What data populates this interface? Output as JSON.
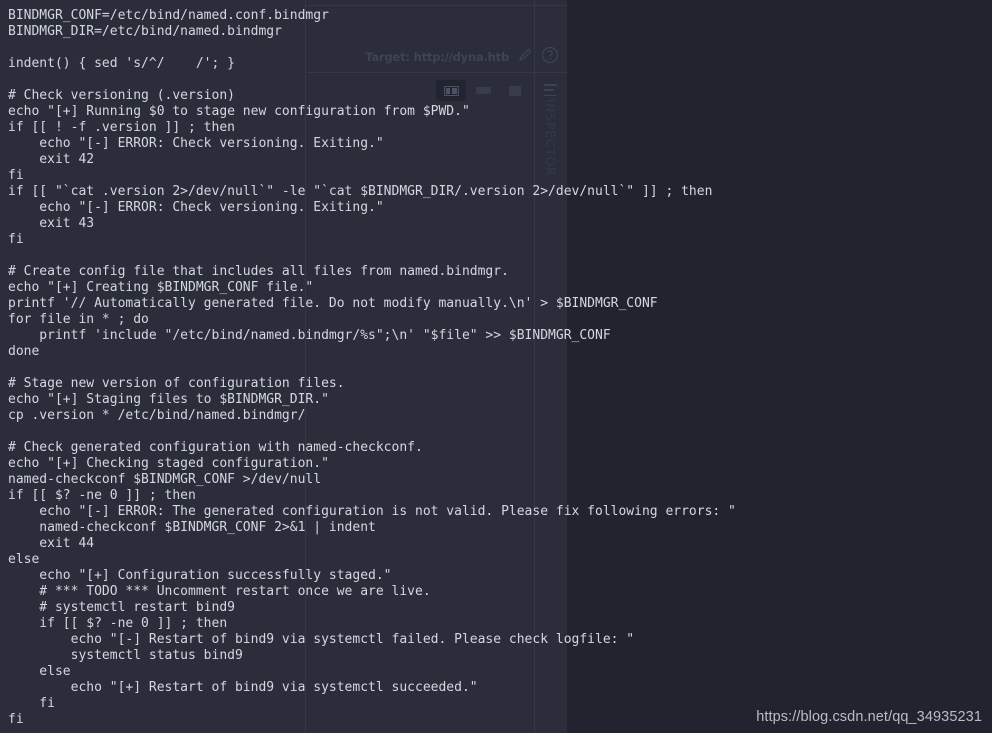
{
  "colors": {
    "page_background": "#21242e",
    "app_panel_background": "#2b2e3a",
    "code_text": "#d3d7e0",
    "muted_ui_text": "#3e4455",
    "watermark_text": "#b9bcc6"
  },
  "background_app": {
    "target_label": "Target: http://dyna.htb",
    "edit_icon": "pencil-icon",
    "help_icon": "question-mark-icon",
    "menu_icon": "hamburger-icon",
    "inspector_label": "INSPECTOR",
    "view_buttons": [
      {
        "name": "view-split-button",
        "icon": "split-view-icon",
        "selected": true
      },
      {
        "name": "view-stacked-button",
        "icon": "stacked-view-icon",
        "selected": false
      },
      {
        "name": "view-single-button",
        "icon": "single-view-icon",
        "selected": false
      }
    ]
  },
  "code": {
    "language": "bash",
    "content": "BINDMGR_CONF=/etc/bind/named.conf.bindmgr\nBINDMGR_DIR=/etc/bind/named.bindmgr\n\nindent() { sed 's/^/    /'; }\n\n# Check versioning (.version)\necho \"[+] Running $0 to stage new configuration from $PWD.\"\nif [[ ! -f .version ]] ; then\n    echo \"[-] ERROR: Check versioning. Exiting.\"\n    exit 42\nfi\nif [[ \"`cat .version 2>/dev/null`\" -le \"`cat $BINDMGR_DIR/.version 2>/dev/null`\" ]] ; then\n    echo \"[-] ERROR: Check versioning. Exiting.\"\n    exit 43\nfi\n\n# Create config file that includes all files from named.bindmgr.\necho \"[+] Creating $BINDMGR_CONF file.\"\nprintf '// Automatically generated file. Do not modify manually.\\n' > $BINDMGR_CONF\nfor file in * ; do\n    printf 'include \"/etc/bind/named.bindmgr/%s\";\\n' \"$file\" >> $BINDMGR_CONF\ndone\n\n# Stage new version of configuration files.\necho \"[+] Staging files to $BINDMGR_DIR.\"\ncp .version * /etc/bind/named.bindmgr/\n\n# Check generated configuration with named-checkconf.\necho \"[+] Checking staged configuration.\"\nnamed-checkconf $BINDMGR_CONF >/dev/null\nif [[ $? -ne 0 ]] ; then\n    echo \"[-] ERROR: The generated configuration is not valid. Please fix following errors: \"\n    named-checkconf $BINDMGR_CONF 2>&1 | indent\n    exit 44\nelse\n    echo \"[+] Configuration successfully staged.\"\n    # *** TODO *** Uncomment restart once we are live.\n    # systemctl restart bind9\n    if [[ $? -ne 0 ]] ; then\n        echo \"[-] Restart of bind9 via systemctl failed. Please check logfile: \"\n        systemctl status bind9\n    else\n        echo \"[+] Restart of bind9 via systemctl succeeded.\"\n    fi\nfi"
  },
  "watermark": {
    "url": "https://blog.csdn.net/qq_34935231"
  }
}
